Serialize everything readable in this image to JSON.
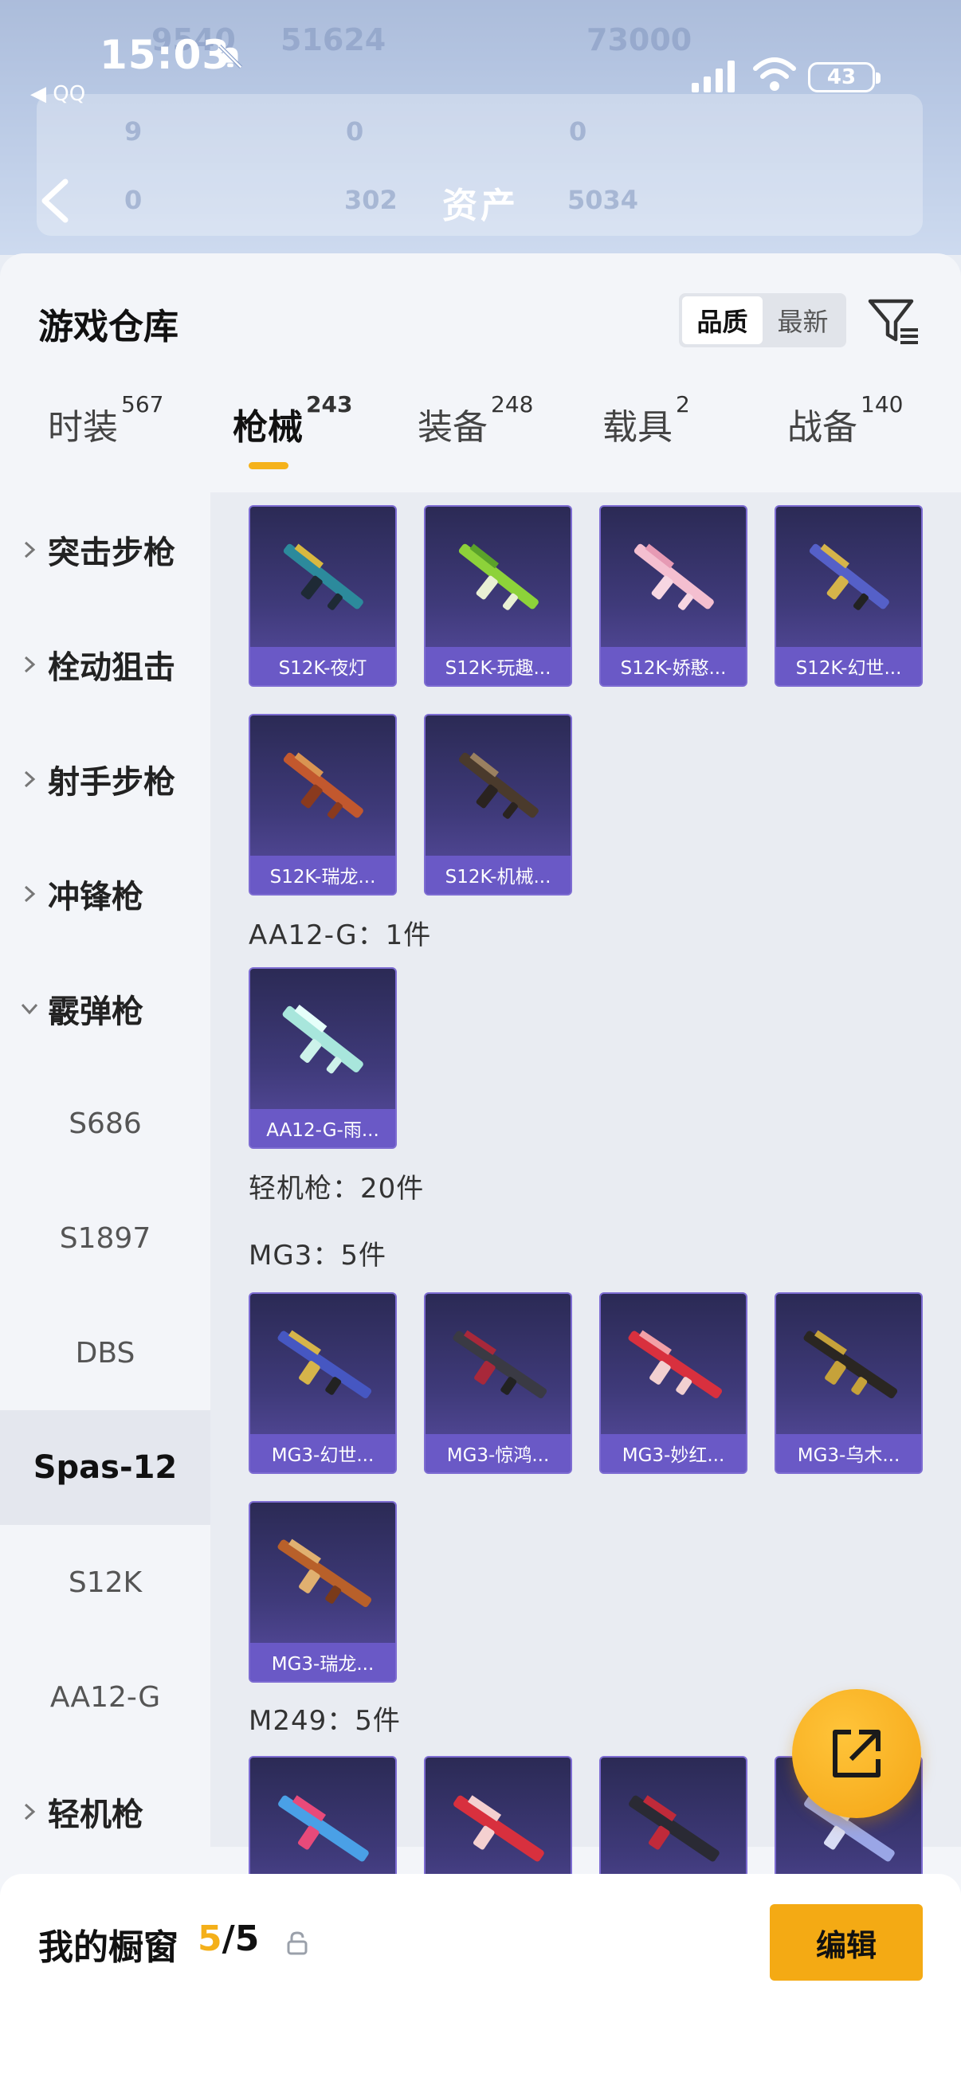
{
  "status_bar": {
    "time": "15:03",
    "back_app": "◀ QQ",
    "battery": "43"
  },
  "header": {
    "title": "资产",
    "ghost_values": [
      "9540",
      "51624",
      "73000",
      "9",
      "0",
      "0",
      "0",
      "302",
      "5034"
    ]
  },
  "warehouse": {
    "title": "游戏仓库",
    "sort_options": [
      "品质",
      "最新"
    ],
    "sort_selected": "品质"
  },
  "tabs": [
    {
      "label": "时装",
      "count": "567"
    },
    {
      "label": "枪械",
      "count": "243",
      "active": true
    },
    {
      "label": "装备",
      "count": "248"
    },
    {
      "label": "载具",
      "count": "2"
    },
    {
      "label": "战备",
      "count": "140"
    }
  ],
  "sidebar": {
    "categories": [
      "突击步枪",
      "栓动狙击",
      "射手步枪",
      "冲锋枪",
      "霰弹枪"
    ],
    "sub_items": [
      "S686",
      "S1897",
      "DBS",
      "Spas-12",
      "S12K",
      "AA12-G"
    ],
    "selected": "Spas-12",
    "bottom_category": "轻机枪"
  },
  "groups": {
    "s12k_items": [
      "S12K-夜灯",
      "S12K-玩趣...",
      "S12K-娇憨...",
      "S12K-幻世...",
      "S12K-瑞龙...",
      "S12K-机械..."
    ],
    "aa12_header": "AA12-G：1件",
    "aa12_items": [
      "AA12-G-雨..."
    ],
    "lmg_header": "轻机枪：20件",
    "mg3_header": "MG3：5件",
    "mg3_items": [
      "MG3-幻世...",
      "MG3-惊鸿...",
      "MG3-妙红...",
      "MG3-乌木...",
      "MG3-瑞龙..."
    ],
    "m249_header": "M249：5件"
  },
  "colors": {
    "accent": "#f4aa14",
    "card_bg": "#3f3a7a",
    "card_caption": "#6a59c6"
  },
  "icons": [
    "bell-mute-icon",
    "signal-icon",
    "wifi-icon",
    "back-icon",
    "filter-icon",
    "chevron-icon",
    "share-icon",
    "lock-icon"
  ],
  "showcase": {
    "title": "我的橱窗",
    "current": "5",
    "total": "/5",
    "edit_label": "编辑"
  }
}
